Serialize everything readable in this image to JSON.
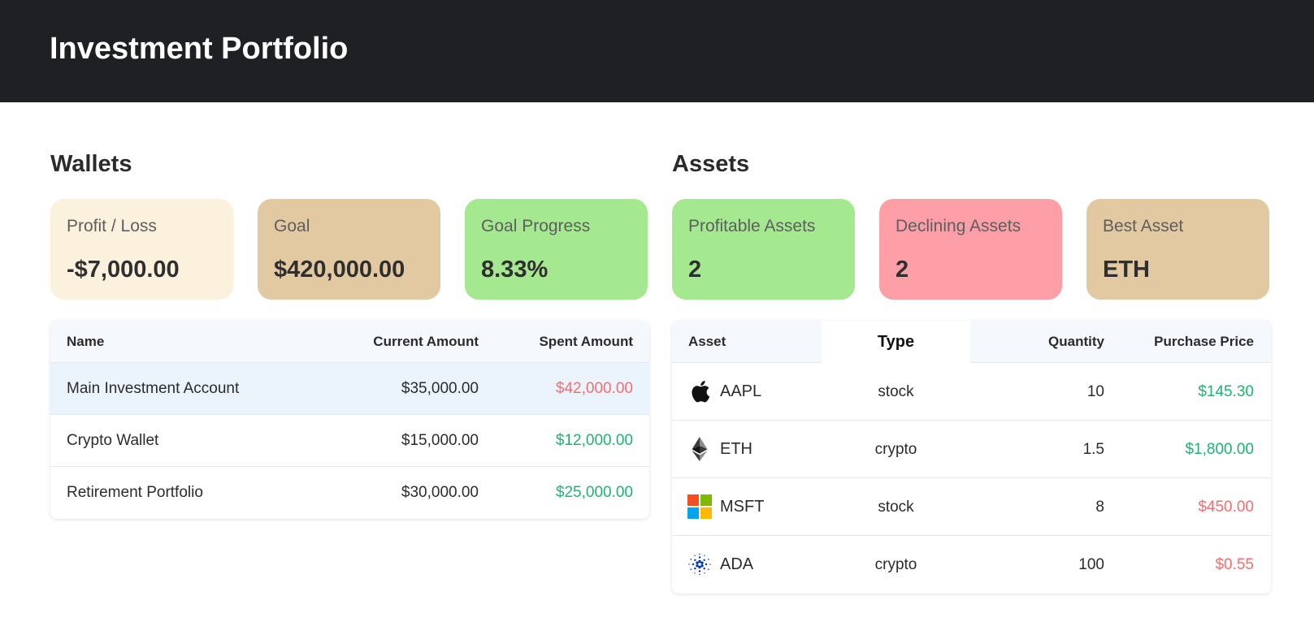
{
  "header": {
    "title": "Investment Portfolio"
  },
  "wallets": {
    "title": "Wallets",
    "cards": [
      {
        "label": "Profit / Loss",
        "value": "-$7,000.00",
        "color": "#fbf1dc"
      },
      {
        "label": "Goal",
        "value": "$420,000.00",
        "color": "#e2c9a1"
      },
      {
        "label": "Goal Progress",
        "value": "8.33%",
        "color": "#a4e890"
      }
    ],
    "table": {
      "headers": {
        "name": "Name",
        "current": "Current Amount",
        "spent": "Spent Amount"
      },
      "rows": [
        {
          "name": "Main Investment Account",
          "current": "$35,000.00",
          "spent": "$42,000.00",
          "spent_color": "#f07070",
          "highlighted": true
        },
        {
          "name": "Crypto Wallet",
          "current": "$15,000.00",
          "spent": "$12,000.00",
          "spent_color": "#1fb373",
          "highlighted": false
        },
        {
          "name": "Retirement Portfolio",
          "current": "$30,000.00",
          "spent": "$25,000.00",
          "spent_color": "#1fb373",
          "highlighted": false
        }
      ]
    }
  },
  "assets": {
    "title": "Assets",
    "cards": [
      {
        "label": "Profitable Assets",
        "value": "2",
        "color": "#a4e890"
      },
      {
        "label": "Declining Assets",
        "value": "2",
        "color": "#fe9ea7"
      },
      {
        "label": "Best Asset",
        "value": "ETH",
        "color": "#e2c9a1"
      }
    ],
    "table": {
      "headers": {
        "asset": "Asset",
        "type": "Type",
        "quantity": "Quantity",
        "price": "Purchase Price"
      },
      "rows": [
        {
          "icon": "apple-icon",
          "ticker": "AAPL",
          "type": "stock",
          "quantity": "10",
          "price": "$145.30",
          "price_color": "#1fb373"
        },
        {
          "icon": "ethereum-icon",
          "ticker": "ETH",
          "type": "crypto",
          "quantity": "1.5",
          "price": "$1,800.00",
          "price_color": "#1fb373"
        },
        {
          "icon": "microsoft-icon",
          "ticker": "MSFT",
          "type": "stock",
          "quantity": "8",
          "price": "$450.00",
          "price_color": "#f07070"
        },
        {
          "icon": "cardano-icon",
          "ticker": "ADA",
          "type": "crypto",
          "quantity": "100",
          "price": "$0.55",
          "price_color": "#f07070"
        }
      ]
    }
  }
}
